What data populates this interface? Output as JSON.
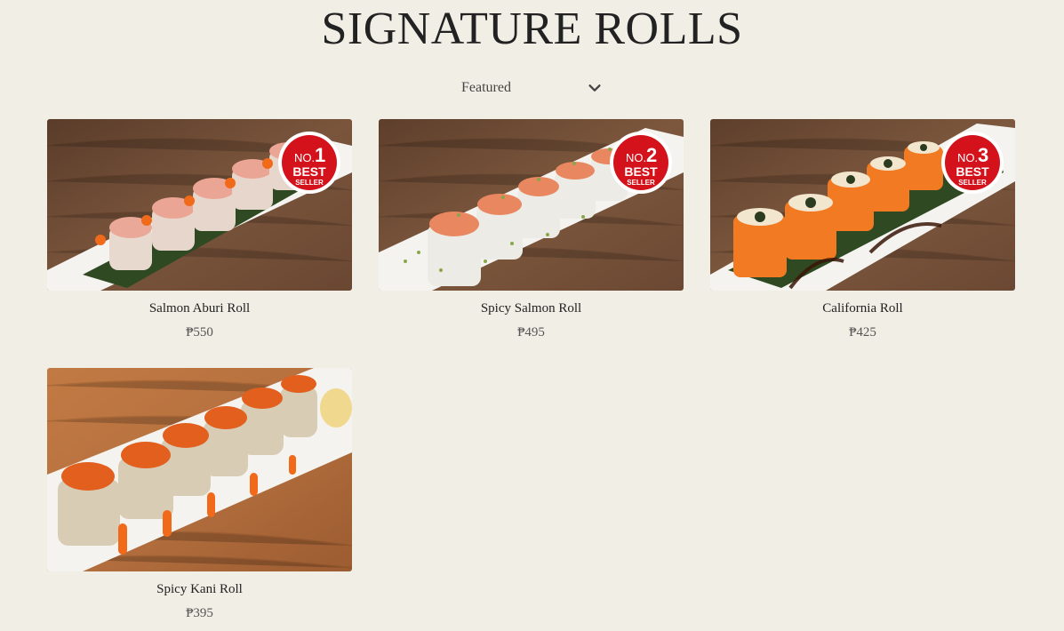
{
  "page": {
    "title": "SIGNATURE ROLLS"
  },
  "sort": {
    "selected": "Featured",
    "icon": "chevron-down-icon"
  },
  "products": [
    {
      "name": "Salmon Aburi Roll",
      "price": "₱550",
      "badge": {
        "rank": "1",
        "no": "NO.",
        "best": "BEST",
        "seller": "SELLER"
      }
    },
    {
      "name": "Spicy Salmon Roll",
      "price": "₱495",
      "badge": {
        "rank": "2",
        "no": "NO.",
        "best": "BEST",
        "seller": "SELLER"
      }
    },
    {
      "name": "California Roll",
      "price": "₱425",
      "badge": {
        "rank": "3",
        "no": "NO.",
        "best": "BEST",
        "seller": "SELLER"
      }
    },
    {
      "name": "Spicy Kani Roll",
      "price": "₱395"
    }
  ],
  "colors": {
    "background": "#f1eee6",
    "badge_red": "#d4121c",
    "wood_dark": "#6e4a33",
    "wood_light": "#b0703f"
  }
}
